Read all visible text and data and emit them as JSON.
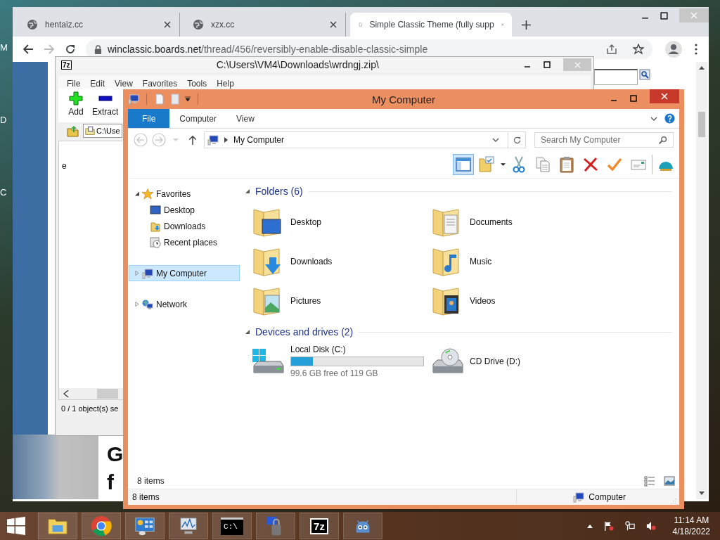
{
  "desktop": {
    "icon_labels": [
      "M",
      "D",
      "C"
    ]
  },
  "browser": {
    "tabs": [
      {
        "title": "hentaiz.cc",
        "kind": "site",
        "selected": false
      },
      {
        "title": "xzx.cc",
        "kind": "site",
        "selected": false
      },
      {
        "title": "Simple Classic Theme (fully supp",
        "kind": "page",
        "selected": true
      }
    ],
    "address": {
      "host": "winclassic.boards.net",
      "path": "/thread/456/reversibly-enable-disable-classic-simple"
    },
    "page": {
      "headline_lines": [
        "G",
        "f"
      ]
    }
  },
  "archiver": {
    "logo": "7z",
    "title": "C:\\Users\\VM4\\Downloads\\wrdngj.zip\\",
    "menu": [
      "File",
      "Edit",
      "View",
      "Favorites",
      "Tools",
      "Help"
    ],
    "toolbar": [
      {
        "label": "Add",
        "kind": "add"
      },
      {
        "label": "Extract",
        "kind": "extract"
      }
    ],
    "path": "C:\\Use",
    "list_text": "e",
    "status": "0 / 1 object(s) se"
  },
  "explorer": {
    "title": "My Computer",
    "ribbon_tabs": [
      {
        "label": "File",
        "selected": true
      },
      {
        "label": "Computer",
        "selected": false
      },
      {
        "label": "View",
        "selected": false
      }
    ],
    "address": "My Computer",
    "search": {
      "placeholder": "Search My Computer"
    },
    "toolbar": [
      {
        "kind": "pane",
        "pressed": true
      },
      {
        "kind": "folder-check",
        "pressed": false
      },
      {
        "kind": "cut",
        "pressed": false
      },
      {
        "kind": "copy",
        "pressed": false
      },
      {
        "kind": "paste",
        "pressed": false
      },
      {
        "kind": "delete",
        "pressed": false
      },
      {
        "kind": "check",
        "pressed": false
      },
      {
        "kind": "mail",
        "pressed": false
      },
      {
        "kind": "shell",
        "pressed": false
      }
    ],
    "nav": [
      {
        "label": "Favorites",
        "kind": "star",
        "expanded": true,
        "selected": false,
        "children": [
          {
            "label": "Desktop",
            "kind": "desktop",
            "selected": false
          },
          {
            "label": "Downloads",
            "kind": "downloads",
            "selected": false
          },
          {
            "label": "Recent places",
            "kind": "recent",
            "selected": false
          }
        ]
      },
      {
        "label": "My Computer",
        "kind": "computer",
        "expanded": false,
        "selected": true
      },
      {
        "label": "Network",
        "kind": "network",
        "expanded": false,
        "selected": false
      }
    ],
    "groups": [
      {
        "title": "Folders (6)",
        "expanded": true,
        "items": [
          {
            "name": "Desktop",
            "kind": "desktop"
          },
          {
            "name": "Documents",
            "kind": "documents"
          },
          {
            "name": "Downloads",
            "kind": "downloads"
          },
          {
            "name": "Music",
            "kind": "music"
          },
          {
            "name": "Pictures",
            "kind": "pictures"
          },
          {
            "name": "Videos",
            "kind": "videos"
          }
        ]
      },
      {
        "title": "Devices and drives (2)",
        "expanded": true,
        "items": [
          {
            "name": "Local Disk (C:)",
            "kind": "disk",
            "level": 0.163,
            "detail": "99.6 GB free of 119 GB"
          },
          {
            "name": "CD Drive (D:)",
            "kind": "cd"
          }
        ]
      }
    ],
    "pane_status": "8 items",
    "status": "8 items",
    "status_right": "Computer"
  },
  "taskbar": {
    "apps": [
      {
        "kind": "explorer"
      },
      {
        "kind": "chrome"
      },
      {
        "kind": "control"
      },
      {
        "kind": "monitor"
      },
      {
        "kind": "console",
        "label": "C:\\"
      },
      {
        "kind": "lock"
      },
      {
        "kind": "sevenzip",
        "label": "7z"
      },
      {
        "kind": "robot"
      }
    ],
    "clock": {
      "time": "11:14 AM",
      "date": "4/18/2022"
    }
  }
}
